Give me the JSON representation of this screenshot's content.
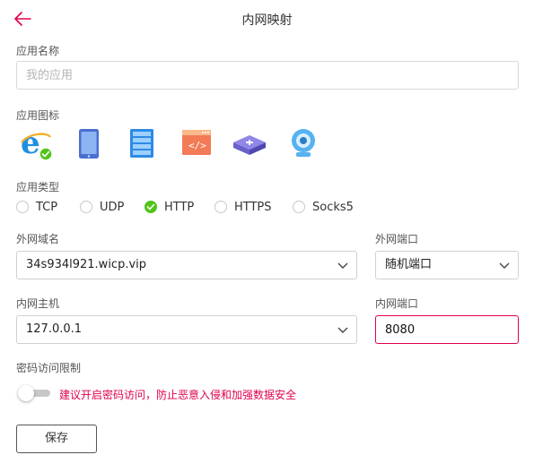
{
  "header": {
    "title": "内网映射",
    "back_icon": "arrow-left-icon"
  },
  "app_name": {
    "label": "应用名称",
    "placeholder": "我的应用",
    "value": ""
  },
  "app_icon": {
    "label": "应用图标",
    "options": [
      {
        "icon": "ie-browser-icon",
        "selected": true
      },
      {
        "icon": "tablet-icon",
        "selected": false
      },
      {
        "icon": "server-icon",
        "selected": false
      },
      {
        "icon": "code-window-icon",
        "selected": false
      },
      {
        "icon": "network-switch-icon",
        "selected": false
      },
      {
        "icon": "webcam-icon",
        "selected": false
      }
    ]
  },
  "app_type": {
    "label": "应用类型",
    "options": [
      "TCP",
      "UDP",
      "HTTP",
      "HTTPS",
      "Socks5"
    ],
    "selected": "HTTP"
  },
  "external_domain": {
    "label": "外网域名",
    "value": "34s934l921.wicp.vip"
  },
  "external_port": {
    "label": "外网端口",
    "value": "随机端口"
  },
  "internal_host": {
    "label": "内网主机",
    "value": "127.0.0.1"
  },
  "internal_port": {
    "label": "内网端口",
    "value": "8080"
  },
  "password_limit": {
    "label": "密码访问限制",
    "enabled": false,
    "warning": "建议开启密码访问，防止恶意入侵和加强数据安全"
  },
  "save_label": "保存",
  "colors": {
    "accent": "#e0004f",
    "check": "#52c41a"
  }
}
